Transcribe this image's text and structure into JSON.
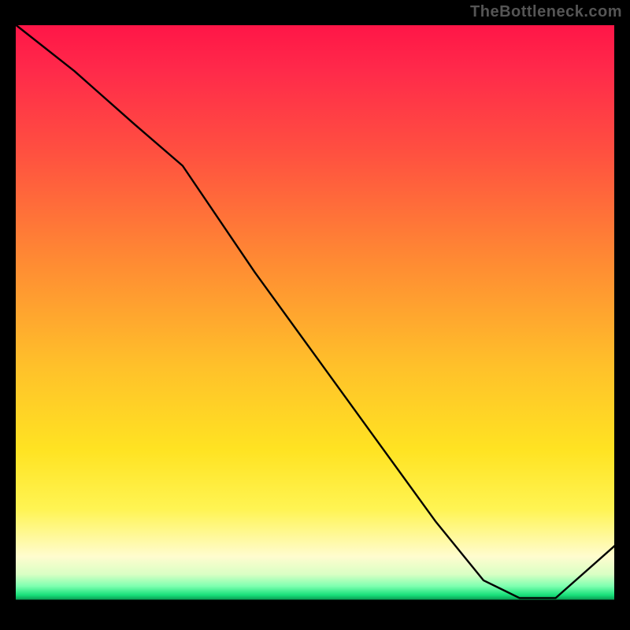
{
  "watermark": "TheBottleneck.com",
  "annotation_text": "",
  "annotation_note": "faint red text near valley — illegible in source",
  "colors": {
    "line": "#000000",
    "annotation": "#d7082a",
    "watermark": "#555555",
    "gradient_top": "#ff1547",
    "gradient_mid": "#ffe322",
    "gradient_green": "#18e07a"
  },
  "chart_data": {
    "type": "line",
    "title": "",
    "xlabel": "",
    "ylabel": "",
    "xlim": [
      0,
      100
    ],
    "ylim": [
      0,
      100
    ],
    "grid": false,
    "legend": false,
    "annotations": [
      {
        "text": "",
        "x": 82,
        "y": 4,
        "color": "#d7082a"
      }
    ],
    "series": [
      {
        "name": "curve",
        "x": [
          0,
          10,
          20,
          28,
          40,
          50,
          60,
          70,
          78,
          84,
          90,
          100
        ],
        "values": [
          100,
          92,
          83,
          76,
          58,
          44,
          30,
          16,
          6,
          3,
          3,
          12
        ]
      }
    ]
  }
}
